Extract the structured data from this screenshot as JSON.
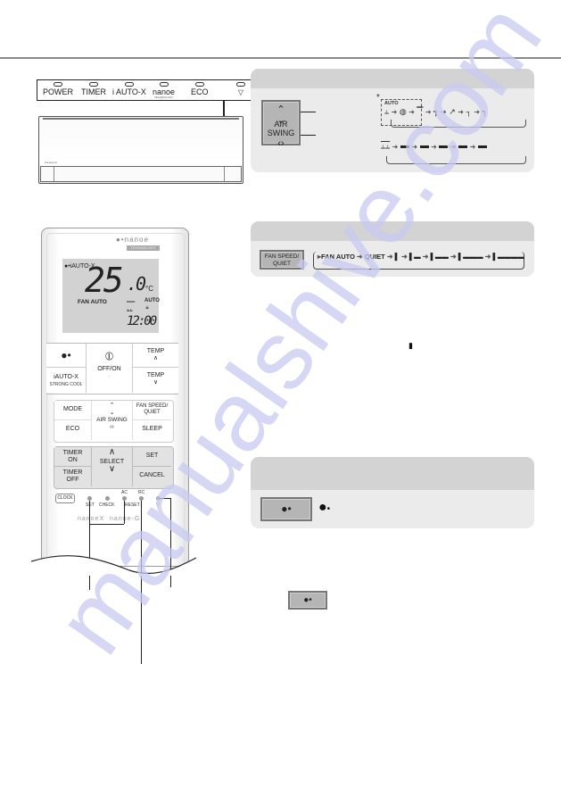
{
  "indoor_unit": {
    "indicators": [
      {
        "label": "POWER"
      },
      {
        "label": "TIMER"
      },
      {
        "label": "i AUTO-X"
      },
      {
        "label": "nanoe",
        "sublabel": "TECHNOLOGY"
      },
      {
        "label": "ECO"
      },
      {
        "label": "",
        "icon": "wifi-icon"
      }
    ],
    "brand_small": "Panasonic"
  },
  "air_swing_box": {
    "button": {
      "up_symbol": "∧∨",
      "label": "AIR SWING",
      "lr_symbol": "‹›"
    },
    "asterisk": "*",
    "vertical_auto_label": "AUTO",
    "vertical_steps": 5,
    "horizontal_steps": 5
  },
  "fan_speed_box": {
    "button_label_line1": "FAN SPEED/",
    "button_label_line2": "QUIET",
    "sequence": [
      "FAN AUTO",
      "QUIET",
      "1",
      "2",
      "3",
      "4",
      "5"
    ]
  },
  "body_marker": "▮",
  "nanoe_box": {
    "button_icon": "nanoe-icon",
    "display_icon": "nanoe-icon"
  },
  "inline_button_icon": "nanoe-icon",
  "remote": {
    "brand": "nanoe",
    "brand_sub": "TECHNOLOGY",
    "lcd": {
      "mode": "iAUTO-X",
      "temperature": "25",
      "decimal": ".0",
      "unit": "°C",
      "fan": "FAN AUTO",
      "swing_label": "AUTO",
      "time": "12:00"
    },
    "buttons": {
      "nanoe": "nanoe",
      "iautox": "iAUTO-X",
      "iautox_sub": "STRONG COOL",
      "offon": "OFF/ON",
      "temp_up": "TEMP",
      "temp_down": "TEMP",
      "mode": "MODE",
      "eco": "ECO",
      "air_swing": "AIR SWING",
      "fan_speed_1": "FAN SPEED/",
      "fan_speed_2": "QUIET",
      "sleep": "SLEEP",
      "timer_on_1": "TIMER",
      "timer_on_2": "ON",
      "timer_off_1": "TIMER",
      "timer_off_2": "OFF",
      "select": "SELECT",
      "set": "SET",
      "cancel": "CANCEL",
      "clock": "CLOCK"
    },
    "pinholes": {
      "set": "SET",
      "check": "CHECK",
      "ac_reset_top": "AC",
      "ac_reset_bottom": "RESET",
      "rc": "RC"
    },
    "footer_brands": [
      "nanoeX",
      "nanoe-G"
    ]
  },
  "watermark": "manualshive.com"
}
